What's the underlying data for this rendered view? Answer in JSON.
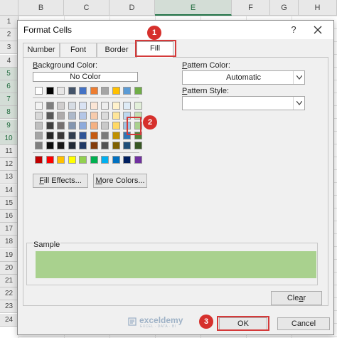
{
  "sheet": {
    "columns": [
      "B",
      "C",
      "D",
      "E",
      "F",
      "G",
      "H"
    ],
    "active_column": "E",
    "rows": [
      "1",
      "2",
      "3",
      "4",
      "5",
      "6",
      "7",
      "8",
      "9",
      "10",
      "11",
      "12",
      "13",
      "14",
      "15",
      "16",
      "17",
      "18",
      "19",
      "20",
      "21",
      "22",
      "23",
      "24"
    ],
    "active_rows": [
      "5",
      "6",
      "7",
      "8",
      "9",
      "10"
    ]
  },
  "dialog": {
    "title": "Format Cells",
    "help_label": "?",
    "tabs": [
      "Number",
      "Font",
      "Border",
      "Fill"
    ],
    "selected_tab": "Fill",
    "background_color_label": "Background Color:",
    "no_color_label": "No Color",
    "theme_top_row": [
      "#ffffff",
      "#000000",
      "#e7e6e6",
      "#44546a",
      "#4472c4",
      "#ed7d31",
      "#a5a5a5",
      "#ffc000",
      "#5b9bd5",
      "#70ad47"
    ],
    "theme_shades": [
      [
        "#f2f2f2",
        "#7f7f7f",
        "#d0cece",
        "#d6dce4",
        "#d9e2f3",
        "#fbe5d5",
        "#ededed",
        "#fff2cc",
        "#deebf6",
        "#e2efd9"
      ],
      [
        "#d8d8d8",
        "#595959",
        "#aeabab",
        "#adb9ca",
        "#b4c6e7",
        "#f7cbac",
        "#dbdbdb",
        "#fee599",
        "#bdd7ee",
        "#c5e0b3"
      ],
      [
        "#bfbfbf",
        "#3f3f3f",
        "#757070",
        "#8496b0",
        "#8eaadb",
        "#f4b183",
        "#c9c9c9",
        "#ffd965",
        "#9cc3e5",
        "#a9d18e"
      ],
      [
        "#a5a5a5",
        "#262626",
        "#3a3838",
        "#323e4f",
        "#2f5496",
        "#c55a11",
        "#7b7b7b",
        "#bf9000",
        "#2e75b5",
        "#538135"
      ],
      [
        "#7f7f7f",
        "#0c0c0c",
        "#171616",
        "#222a35",
        "#1f3864",
        "#833c0b",
        "#525252",
        "#7f6000",
        "#1e4e79",
        "#375623"
      ]
    ],
    "standard_colors": [
      "#c00000",
      "#ff0000",
      "#ffc000",
      "#ffff00",
      "#92d050",
      "#00b050",
      "#00b0f0",
      "#0070c0",
      "#002060",
      "#7030a0"
    ],
    "fill_effects_label": "Fill Effects...",
    "more_colors_label": "More Colors...",
    "pattern_color_label": "Pattern Color:",
    "pattern_color_value": "Automatic",
    "pattern_style_label": "Pattern Style:",
    "pattern_style_value": "",
    "sample_label": "Sample",
    "sample_color": "#a9d18e",
    "clear_label": "Clear",
    "ok_label": "OK",
    "cancel_label": "Cancel"
  },
  "callouts": [
    "1",
    "2",
    "3"
  ],
  "watermark": {
    "name": "exceldemy",
    "tagline": "EXCEL · DATA · BI"
  },
  "highlight_color": "#d43a3a"
}
